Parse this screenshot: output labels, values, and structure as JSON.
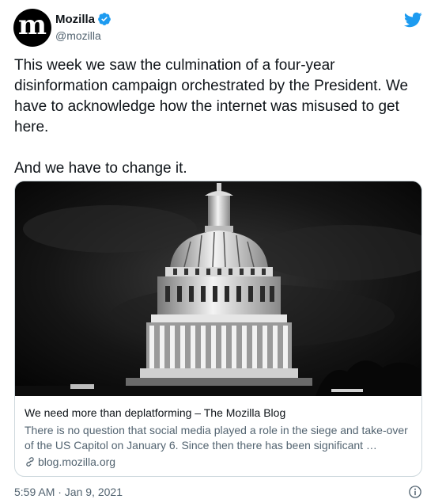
{
  "account": {
    "avatar_letter": "m",
    "name": "Mozilla",
    "handle": "@mozilla"
  },
  "tweet": {
    "text": "This week we saw the culmination of a four-year disinformation campaign orchestrated by the President. We have to acknowledge how the internet was misused to get here.\n\nAnd we have to change it.",
    "timestamp": "5:59 AM · Jan 9, 2021"
  },
  "card": {
    "title": "We need more than deplatforming – The Mozilla Blog",
    "description": "There is no question that social media played a role in the siege and take-over of the US Capitol on January 6. Since then there has been significant …",
    "domain": "blog.mozilla.org"
  },
  "colors": {
    "verified": "#1d9bf0",
    "twitter_bird": "#1d9bf0",
    "secondary_text": "#536471"
  },
  "icons": [
    "verified-badge-icon",
    "twitter-bird-icon",
    "link-icon",
    "info-icon"
  ]
}
